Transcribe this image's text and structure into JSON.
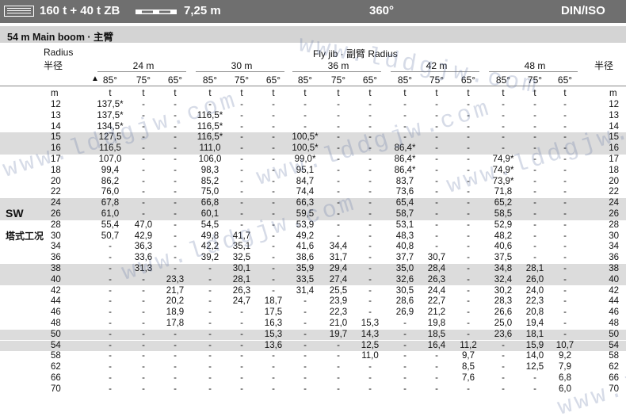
{
  "header": {
    "title": "160 t + 40 t ZB",
    "length": "7,25 m",
    "slew": "360°",
    "standard": "DIN/ISO"
  },
  "subheader": "54 m  Main boom · 主臂",
  "labels": {
    "radius_en": "Radius",
    "radius_cn": "半径",
    "fly_jib": "Fly jib · 副臂 Radius",
    "radius_cn_right": "半径",
    "unit_m": "m",
    "unit_t": "t",
    "sw_en": "SW",
    "sw_cn": "塔式工况",
    "triangle": "▲"
  },
  "jibs": [
    "24 m",
    "30 m",
    "36 m",
    "42 m",
    "48 m"
  ],
  "angles": [
    "85°",
    "75°",
    "65°"
  ],
  "radii": [
    "12",
    "13",
    "14",
    "15",
    "16",
    "17",
    "18",
    "20",
    "22",
    "24",
    "26",
    "28",
    "30",
    "34",
    "36",
    "38",
    "40",
    "42",
    "44",
    "46",
    "48",
    "50",
    "54",
    "58",
    "62",
    "66",
    "70"
  ],
  "rows": [
    [
      "137,5*",
      "-",
      "-",
      "-",
      "-",
      "-",
      "-",
      "-",
      "-",
      "-",
      "-",
      "-",
      "-",
      "-",
      "-"
    ],
    [
      "137,5*",
      "-",
      "-",
      "116,5*",
      "-",
      "-",
      "-",
      "-",
      "-",
      "-",
      "-",
      "-",
      "-",
      "-",
      "-"
    ],
    [
      "134,5*",
      "-",
      "-",
      "116,5*",
      "-",
      "-",
      "-",
      "-",
      "-",
      "-",
      "-",
      "-",
      "-",
      "-",
      "-"
    ],
    [
      "127,5",
      "-",
      "-",
      "116,5*",
      "-",
      "-",
      "100,5*",
      "-",
      "-",
      "-",
      "-",
      "-",
      "-",
      "-",
      "-"
    ],
    [
      "116,5",
      "-",
      "-",
      "111,0",
      "-",
      "-",
      "100,5*",
      "-",
      "-",
      "86,4*",
      "-",
      "-",
      "-",
      "-",
      "-"
    ],
    [
      "107,0",
      "-",
      "-",
      "106,0",
      "-",
      "-",
      "99,0*",
      "-",
      "-",
      "86,4*",
      "-",
      "-",
      "74,9*",
      "-",
      "-"
    ],
    [
      "99,4",
      "-",
      "-",
      "98,3",
      "-",
      "-",
      "95,1",
      "-",
      "-",
      "86,4*",
      "-",
      "-",
      "74,9*",
      "-",
      "-"
    ],
    [
      "86,2",
      "-",
      "-",
      "85,2",
      "-",
      "-",
      "84,7",
      "-",
      "-",
      "83,7",
      "-",
      "-",
      "73,9*",
      "-",
      "-"
    ],
    [
      "76,0",
      "-",
      "-",
      "75,0",
      "-",
      "-",
      "74,4",
      "-",
      "-",
      "73,6",
      "-",
      "-",
      "71,8",
      "-",
      "-"
    ],
    [
      "67,8",
      "-",
      "-",
      "66,8",
      "-",
      "-",
      "66,3",
      "-",
      "-",
      "65,4",
      "-",
      "-",
      "65,2",
      "-",
      "-"
    ],
    [
      "61,0",
      "-",
      "-",
      "60,1",
      "-",
      "-",
      "59,5",
      "-",
      "-",
      "58,7",
      "-",
      "-",
      "58,5",
      "-",
      "-"
    ],
    [
      "55,4",
      "47,0",
      "-",
      "54,5",
      "-",
      "-",
      "53,9",
      "-",
      "-",
      "53,1",
      "-",
      "-",
      "52,9",
      "-",
      "-"
    ],
    [
      "50,7",
      "42,9",
      "-",
      "49,8",
      "41,7",
      "-",
      "49,2",
      "-",
      "-",
      "48,3",
      "-",
      "-",
      "48,2",
      "-",
      "-"
    ],
    [
      "-",
      "36,3",
      "-",
      "42,2",
      "35,1",
      "-",
      "41,6",
      "34,4",
      "-",
      "40,8",
      "-",
      "-",
      "40,6",
      "-",
      "-"
    ],
    [
      "-",
      "33,6",
      "-",
      "39,2",
      "32,5",
      "-",
      "38,6",
      "31,7",
      "-",
      "37,7",
      "30,7",
      "-",
      "37,5",
      "-",
      "-"
    ],
    [
      "-",
      "31,3",
      "-",
      "-",
      "30,1",
      "-",
      "35,9",
      "29,4",
      "-",
      "35,0",
      "28,4",
      "-",
      "34,8",
      "28,1",
      "-"
    ],
    [
      "-",
      "-",
      "23,3",
      "-",
      "28,1",
      "-",
      "33,5",
      "27,4",
      "-",
      "32,6",
      "26,3",
      "-",
      "32,4",
      "26,0",
      "-"
    ],
    [
      "-",
      "-",
      "21,7",
      "-",
      "26,3",
      "-",
      "31,4",
      "25,5",
      "-",
      "30,5",
      "24,4",
      "-",
      "30,2",
      "24,0",
      "-"
    ],
    [
      "-",
      "-",
      "20,2",
      "-",
      "24,7",
      "18,7",
      "-",
      "23,9",
      "-",
      "28,6",
      "22,7",
      "-",
      "28,3",
      "22,3",
      "-"
    ],
    [
      "-",
      "-",
      "18,9",
      "-",
      "-",
      "17,5",
      "-",
      "22,3",
      "-",
      "26,9",
      "21,2",
      "-",
      "26,6",
      "20,8",
      "-"
    ],
    [
      "-",
      "-",
      "17,8",
      "-",
      "-",
      "16,3",
      "-",
      "21,0",
      "15,3",
      "-",
      "19,8",
      "-",
      "25,0",
      "19,4",
      "-"
    ],
    [
      "-",
      "-",
      "-",
      "-",
      "-",
      "15,3",
      "-",
      "19,7",
      "14,3",
      "-",
      "18,5",
      "-",
      "23,6",
      "18,1",
      "-"
    ],
    [
      "-",
      "-",
      "-",
      "-",
      "-",
      "13,6",
      "-",
      "-",
      "12,5",
      "-",
      "16,4",
      "11,2",
      "-",
      "15,9",
      "10,7"
    ],
    [
      "-",
      "-",
      "-",
      "-",
      "-",
      "-",
      "-",
      "-",
      "11,0",
      "-",
      "-",
      "9,7",
      "-",
      "14,0",
      "9,2"
    ],
    [
      "-",
      "-",
      "-",
      "-",
      "-",
      "-",
      "-",
      "-",
      "-",
      "-",
      "-",
      "8,5",
      "-",
      "12,5",
      "7,9"
    ],
    [
      "-",
      "-",
      "-",
      "-",
      "-",
      "-",
      "-",
      "-",
      "-",
      "-",
      "-",
      "7,6",
      "-",
      "-",
      "6,8"
    ],
    [
      "-",
      "-",
      "-",
      "-",
      "-",
      "-",
      "-",
      "-",
      "-",
      "-",
      "-",
      "-",
      "-",
      "-",
      "6,0"
    ]
  ],
  "watermark": "www.lddgjw.com"
}
